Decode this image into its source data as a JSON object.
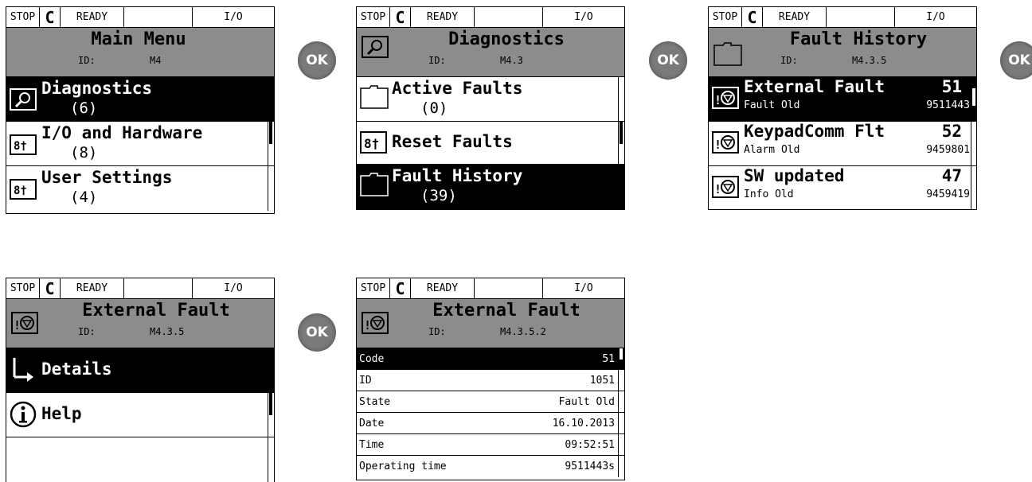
{
  "ok_label": "OK",
  "status": {
    "stop": "STOP",
    "ready": "READY",
    "io": "I/O"
  },
  "panels": {
    "main_menu": {
      "title": "Main Menu",
      "id_label": "ID:",
      "id_value": "M4",
      "items": [
        {
          "label": "Diagnostics",
          "count": "(6)",
          "icon": "diagnostics-icon"
        },
        {
          "label": "I/O and Hardware",
          "count": "(8)",
          "icon": "io-hardware-icon"
        },
        {
          "label": "User Settings",
          "count": "(4)",
          "icon": "user-settings-icon"
        }
      ]
    },
    "diagnostics": {
      "title": "Diagnostics",
      "id_label": "ID:",
      "id_value": "M4.3",
      "items": [
        {
          "label": "Active Faults",
          "count": "(0)",
          "icon": "folder-icon"
        },
        {
          "label": "Reset Faults",
          "count": "",
          "icon": "reset-icon"
        },
        {
          "label": "Fault History",
          "count": "(39)",
          "icon": "folder-icon"
        }
      ]
    },
    "fault_history": {
      "title": "Fault History",
      "id_label": "ID:",
      "id_value": "M4.3.5",
      "items": [
        {
          "label": "External Fault",
          "number": "51",
          "sub": "Fault Old",
          "code": "9511443"
        },
        {
          "label": "KeypadComm Flt",
          "number": "52",
          "sub": "Alarm Old",
          "code": "9459801"
        },
        {
          "label": "SW updated",
          "number": "47",
          "sub": "Info Old",
          "code": "9459419"
        }
      ]
    },
    "external_fault": {
      "title": "External Fault",
      "id_label": "ID:",
      "id_value": "M4.3.5",
      "items": [
        {
          "label": "Details",
          "icon": "details-arrow-icon"
        },
        {
          "label": "Help",
          "icon": "info-icon"
        }
      ]
    },
    "fault_details": {
      "title": "External Fault",
      "id_label": "ID:",
      "id_value": "M4.3.5.2",
      "rows": [
        {
          "key": "Code",
          "value": "51"
        },
        {
          "key": "ID",
          "value": "1051"
        },
        {
          "key": "State",
          "value": "Fault Old"
        },
        {
          "key": "Date",
          "value": "16.10.2013"
        },
        {
          "key": "Time",
          "value": "09:52:51"
        },
        {
          "key": "Operating time",
          "value": "9511443s"
        }
      ]
    }
  }
}
